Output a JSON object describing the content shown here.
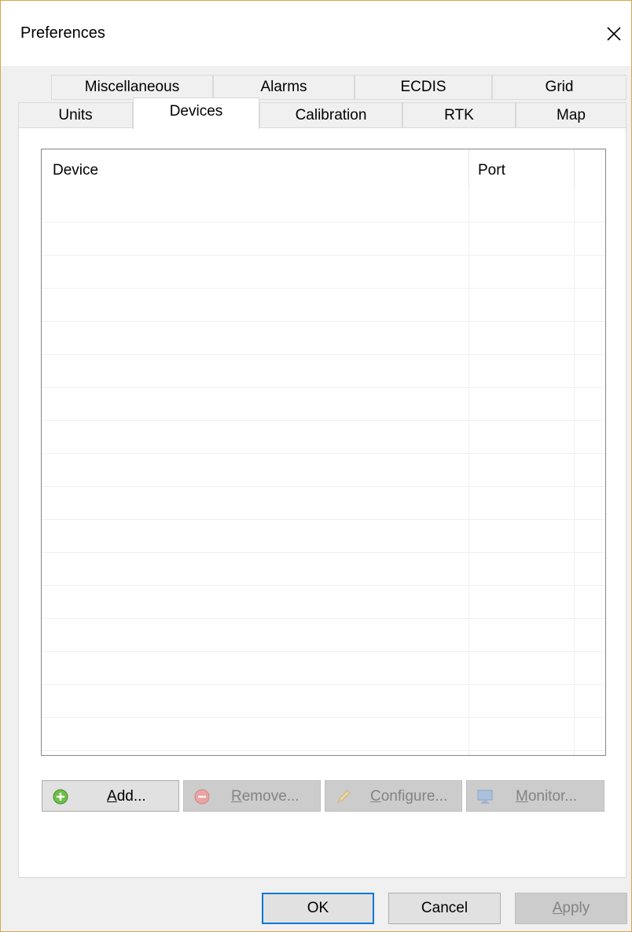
{
  "window": {
    "title": "Preferences"
  },
  "tabs": {
    "row_back": [
      {
        "label": "Miscellaneous"
      },
      {
        "label": "Alarms"
      },
      {
        "label": "ECDIS"
      },
      {
        "label": "Grid"
      }
    ],
    "row_front": [
      {
        "label": "Units"
      },
      {
        "label": "Devices",
        "active": true
      },
      {
        "label": "Calibration"
      },
      {
        "label": "RTK"
      },
      {
        "label": "Map"
      }
    ]
  },
  "device_list": {
    "columns": [
      "Device",
      "Port"
    ],
    "rows": []
  },
  "actions": {
    "add": {
      "label_first": "A",
      "label_rest": "dd...",
      "enabled": true,
      "icon": "add-icon"
    },
    "remove": {
      "label_first": "R",
      "label_rest": "emove...",
      "enabled": false,
      "icon": "remove-icon"
    },
    "configure": {
      "label_first": "C",
      "label_rest": "onfigure...",
      "enabled": false,
      "icon": "pencil-icon"
    },
    "monitor": {
      "label_first": "M",
      "label_rest": "onitor...",
      "enabled": false,
      "icon": "monitor-icon"
    }
  },
  "footer": {
    "ok": "OK",
    "cancel": "Cancel",
    "apply_first": "A",
    "apply_rest": "pply"
  },
  "colors": {
    "default_button_border": "#0078d7",
    "window_border": "#d7a54a"
  }
}
